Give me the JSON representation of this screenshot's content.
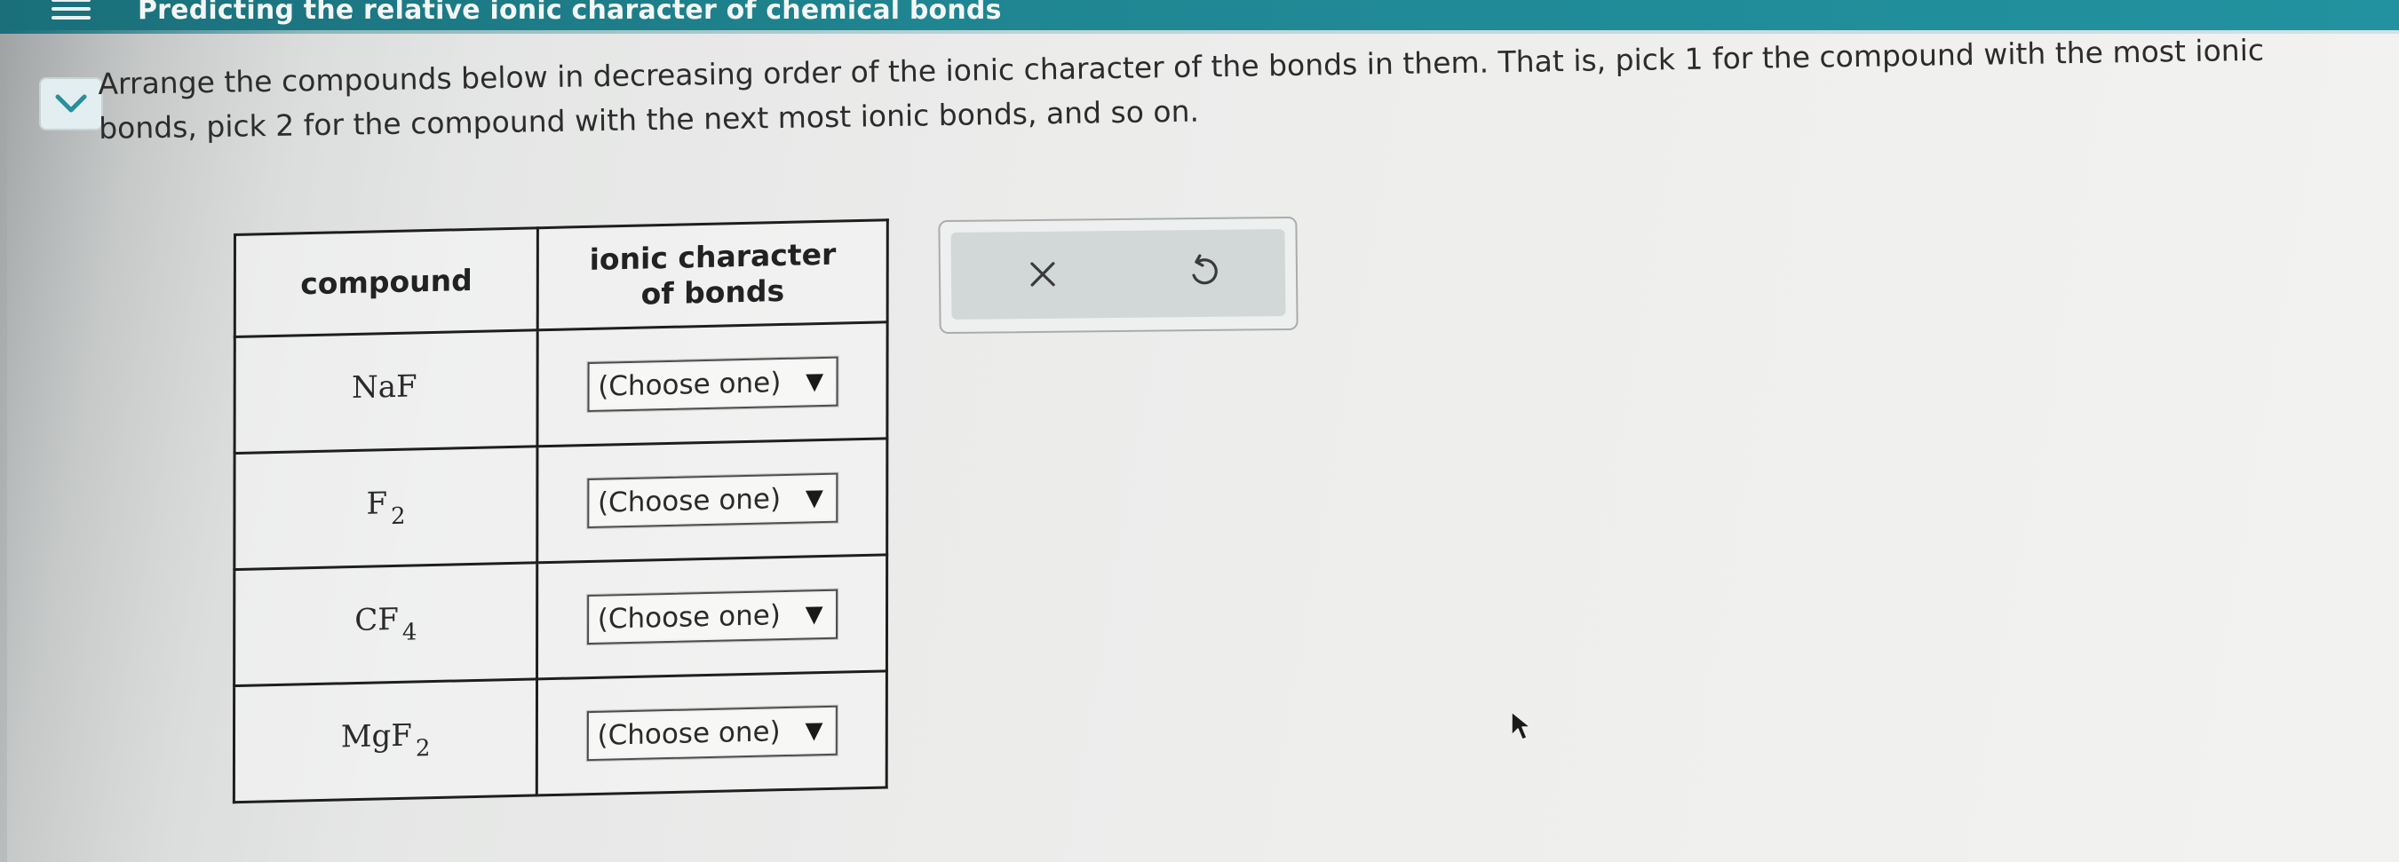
{
  "header": {
    "title": "Predicting the relative ionic character of chemical bonds"
  },
  "instructions": "Arrange the compounds below in decreasing order of the ionic character of the bonds in them. That is, pick 1 for the compound with the most ionic bonds, pick 2 for the compound with the next most ionic bonds, and so on.",
  "table": {
    "headers": {
      "compound": "compound",
      "ionic_line1": "ionic character",
      "ionic_line2": "of bonds"
    },
    "rows": [
      {
        "base": "NaF",
        "sub": "",
        "select": "(Choose one)"
      },
      {
        "base": "F",
        "sub": "2",
        "select": "(Choose one)"
      },
      {
        "base": "CF",
        "sub": "4",
        "select": "(Choose one)"
      },
      {
        "base": "MgF",
        "sub": "2",
        "select": "(Choose one)"
      }
    ]
  },
  "icons": {
    "menu": "menu-icon",
    "collapse": "chevron-down-icon",
    "clear": "close-icon",
    "undo": "undo-icon",
    "cursor": "mouse-pointer-icon"
  },
  "colors": {
    "header_bar": "#1f8691",
    "accent": "#2a8f9c"
  }
}
